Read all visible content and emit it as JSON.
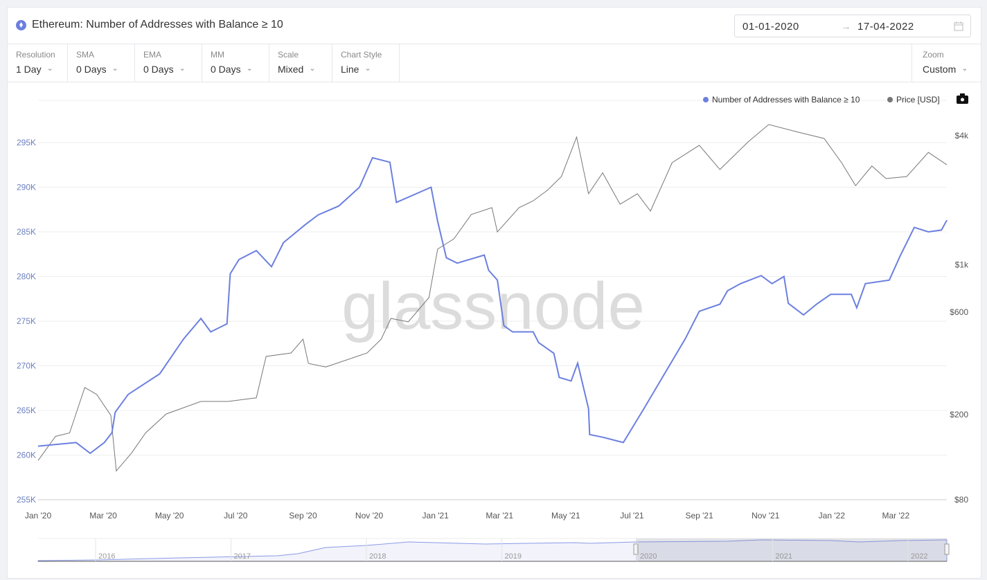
{
  "header": {
    "title": "Ethereum: Number of Addresses with Balance ≥ 10",
    "date_from": "01-01-2020",
    "date_arrow": "→",
    "date_to": "17-04-2022"
  },
  "toolbar": [
    {
      "label": "Resolution",
      "value": "1 Day"
    },
    {
      "label": "SMA",
      "value": "0 Days"
    },
    {
      "label": "EMA",
      "value": "0 Days"
    },
    {
      "label": "MM",
      "value": "0 Days"
    },
    {
      "label": "Scale",
      "value": "Mixed"
    },
    {
      "label": "Chart Style",
      "value": "Line"
    }
  ],
  "zoom": {
    "label": "Zoom",
    "value": "Custom"
  },
  "watermark": "glassnode",
  "colors": {
    "addresses": "#6b7fe0",
    "price": "#777777"
  },
  "chart_data": {
    "type": "line",
    "title": "",
    "legend": {
      "placement": "top-right",
      "entries": [
        "Number of Addresses with Balance ≥ 10",
        "Price [USD]"
      ]
    },
    "x_ticks": [
      "Jan '20",
      "Mar '20",
      "May '20",
      "Jul '20",
      "Sep '20",
      "Nov '20",
      "Jan '21",
      "Mar '21",
      "May '21",
      "Jul '21",
      "Sep '21",
      "Nov '21",
      "Jan '22",
      "Mar '22"
    ],
    "x_tick_dates": [
      "2020-01-01",
      "2020-03-01",
      "2020-05-01",
      "2020-07-01",
      "2020-09-01",
      "2020-11-01",
      "2021-01-01",
      "2021-03-01",
      "2021-05-01",
      "2021-07-01",
      "2021-09-01",
      "2021-11-01",
      "2022-01-01",
      "2022-03-01"
    ],
    "xlim": [
      "2020-01-01",
      "2022-04-17"
    ],
    "y_left": {
      "ticks": [
        "295K",
        "290K",
        "285K",
        "280K",
        "275K",
        "270K",
        "265K",
        "260K",
        "255K"
      ],
      "tick_values": [
        295000,
        290000,
        285000,
        280000,
        275000,
        270000,
        265000,
        260000,
        255000
      ],
      "range": [
        255000,
        295000
      ],
      "scale": "linear"
    },
    "y_right": {
      "ticks": [
        "$4k",
        "$1k",
        "$600",
        "$200",
        "$80"
      ],
      "tick_values": [
        4000,
        1000,
        600,
        200,
        80
      ],
      "range": [
        80,
        4000
      ],
      "scale": "log"
    },
    "grid": true,
    "series": [
      {
        "name": "Number of Addresses with Balance ≥ 10",
        "axis": "left",
        "points": [
          [
            "2020-01-01",
            261000
          ],
          [
            "2020-02-05",
            261400
          ],
          [
            "2020-02-18",
            260200
          ],
          [
            "2020-03-02",
            261400
          ],
          [
            "2020-03-09",
            262500
          ],
          [
            "2020-03-12",
            264800
          ],
          [
            "2020-03-24",
            266800
          ],
          [
            "2020-04-22",
            269100
          ],
          [
            "2020-05-14",
            273000
          ],
          [
            "2020-05-30",
            275300
          ],
          [
            "2020-06-08",
            273800
          ],
          [
            "2020-06-23",
            274700
          ],
          [
            "2020-06-26",
            280300
          ],
          [
            "2020-07-04",
            281900
          ],
          [
            "2020-07-20",
            282900
          ],
          [
            "2020-08-03",
            281100
          ],
          [
            "2020-08-14",
            283800
          ],
          [
            "2020-09-03",
            285800
          ],
          [
            "2020-09-15",
            286900
          ],
          [
            "2020-10-04",
            287900
          ],
          [
            "2020-10-23",
            290000
          ],
          [
            "2020-11-04",
            293300
          ],
          [
            "2020-11-20",
            292800
          ],
          [
            "2020-11-26",
            288300
          ],
          [
            "2020-12-28",
            290000
          ],
          [
            "2021-01-03",
            286200
          ],
          [
            "2021-01-11",
            282100
          ],
          [
            "2021-01-21",
            281500
          ],
          [
            "2021-02-15",
            282400
          ],
          [
            "2021-02-19",
            280700
          ],
          [
            "2021-02-27",
            279600
          ],
          [
            "2021-03-05",
            274500
          ],
          [
            "2021-03-13",
            273800
          ],
          [
            "2021-04-01",
            273800
          ],
          [
            "2021-04-06",
            272600
          ],
          [
            "2021-04-20",
            271400
          ],
          [
            "2021-04-25",
            268700
          ],
          [
            "2021-05-06",
            268300
          ],
          [
            "2021-05-12",
            270300
          ],
          [
            "2021-05-22",
            265200
          ],
          [
            "2021-05-23",
            262300
          ],
          [
            "2021-06-04",
            262000
          ],
          [
            "2021-06-23",
            261400
          ],
          [
            "2021-07-12",
            265200
          ],
          [
            "2021-07-31",
            269100
          ],
          [
            "2021-08-19",
            273000
          ],
          [
            "2021-09-01",
            276100
          ],
          [
            "2021-09-20",
            276900
          ],
          [
            "2021-09-27",
            278400
          ],
          [
            "2021-10-09",
            279200
          ],
          [
            "2021-10-28",
            280100
          ],
          [
            "2021-11-07",
            279200
          ],
          [
            "2021-11-18",
            280000
          ],
          [
            "2021-11-22",
            277000
          ],
          [
            "2021-12-06",
            275700
          ],
          [
            "2021-12-18",
            276900
          ],
          [
            "2021-12-31",
            278000
          ],
          [
            "2022-01-19",
            278000
          ],
          [
            "2022-01-24",
            276500
          ],
          [
            "2022-02-01",
            279200
          ],
          [
            "2022-02-23",
            279600
          ],
          [
            "2022-03-05",
            282300
          ],
          [
            "2022-03-18",
            285500
          ],
          [
            "2022-03-31",
            285000
          ],
          [
            "2022-04-12",
            285200
          ],
          [
            "2022-04-17",
            286300
          ]
        ]
      },
      {
        "name": "Price [USD]",
        "axis": "right",
        "points": [
          [
            "2020-01-01",
            122
          ],
          [
            "2020-01-17",
            158
          ],
          [
            "2020-01-30",
            164
          ],
          [
            "2020-02-13",
            267
          ],
          [
            "2020-02-24",
            248
          ],
          [
            "2020-03-08",
            198
          ],
          [
            "2020-03-13",
            109
          ],
          [
            "2020-03-27",
            132
          ],
          [
            "2020-04-09",
            164
          ],
          [
            "2020-04-28",
            201
          ],
          [
            "2020-05-30",
            230
          ],
          [
            "2020-06-24",
            230
          ],
          [
            "2020-07-20",
            239
          ],
          [
            "2020-07-29",
            373
          ],
          [
            "2020-08-21",
            387
          ],
          [
            "2020-09-01",
            449
          ],
          [
            "2020-09-06",
            346
          ],
          [
            "2020-09-22",
            333
          ],
          [
            "2020-10-11",
            359
          ],
          [
            "2020-10-30",
            387
          ],
          [
            "2020-11-12",
            449
          ],
          [
            "2020-11-21",
            561
          ],
          [
            "2020-12-07",
            541
          ],
          [
            "2020-12-26",
            702
          ],
          [
            "2021-01-03",
            1181
          ],
          [
            "2021-01-18",
            1321
          ],
          [
            "2021-02-03",
            1714
          ],
          [
            "2021-02-22",
            1845
          ],
          [
            "2021-02-27",
            1422
          ],
          [
            "2021-03-19",
            1845
          ],
          [
            "2021-04-01",
            1987
          ],
          [
            "2021-04-14",
            2223
          ],
          [
            "2021-04-27",
            2578
          ],
          [
            "2021-05-11",
            3940
          ],
          [
            "2021-05-22",
            2143
          ],
          [
            "2021-06-04",
            2682
          ],
          [
            "2021-06-20",
            1914
          ],
          [
            "2021-07-06",
            2143
          ],
          [
            "2021-07-18",
            1778
          ],
          [
            "2021-08-07",
            2992
          ],
          [
            "2021-09-01",
            3606
          ],
          [
            "2021-09-20",
            2781
          ],
          [
            "2021-10-16",
            3740
          ],
          [
            "2021-11-04",
            4508
          ],
          [
            "2021-11-29",
            4180
          ],
          [
            "2021-12-25",
            3880
          ],
          [
            "2022-01-10",
            2992
          ],
          [
            "2022-01-23",
            2337
          ],
          [
            "2022-02-07",
            2886
          ],
          [
            "2022-02-20",
            2523
          ],
          [
            "2022-03-11",
            2578
          ],
          [
            "2022-03-31",
            3342
          ],
          [
            "2022-04-17",
            2925
          ]
        ]
      }
    ]
  },
  "navigator": {
    "years": [
      "2016",
      "2017",
      "2018",
      "2019",
      "2020",
      "2021",
      "2022"
    ]
  }
}
